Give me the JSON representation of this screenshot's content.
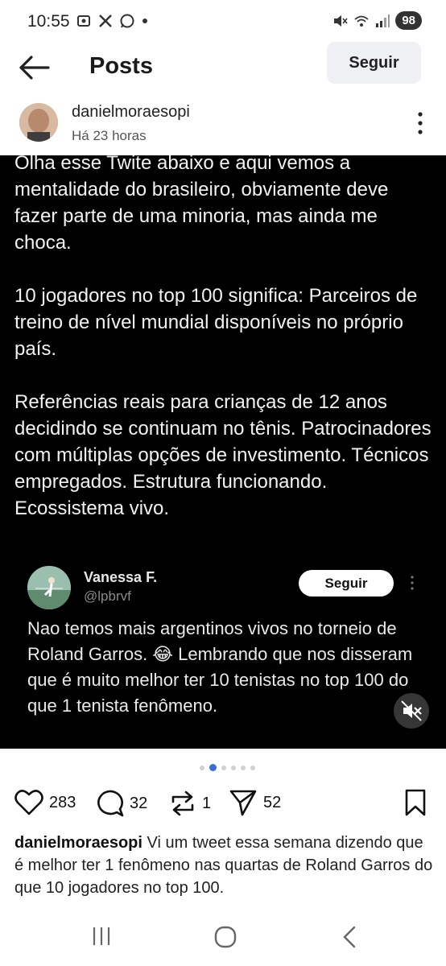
{
  "status_bar": {
    "time": "10:55",
    "battery": "98"
  },
  "header": {
    "title": "Posts",
    "follow_label": "Seguir"
  },
  "post": {
    "username": "danielmoraesopi",
    "timestamp": "Há 23 horas",
    "media_text": [
      "Olha esse Twite abaixo e aqui vemos a mentalidade do brasileiro, obviamente deve fazer parte de uma minoria, mas ainda me choca.",
      "10 jogadores no top 100 significa: Parceiros de treino de nível mundial disponíveis no próprio país.",
      "Referências reais para crianças de 12 anos decidindo se continuam no tênis. Patrocinadores com múltiplas opções de investimento. Técnicos empregados. Estrutura funcionando. Ecossistema vivo."
    ],
    "embedded": {
      "name": "Vanessa F.",
      "handle": "@lpbrvf",
      "follow_label": "Seguir",
      "text": "Nao temos mais argentinos vivos no torneio de Roland Garros. 😂 Lembrando que nos disseram que é muito melhor ter 10 tenistas no top 100 do que 1 tenista fenômeno."
    },
    "likes": "283",
    "comments": "32",
    "reposts": "1",
    "shares": "52",
    "caption_user": "danielmoraesopi",
    "caption_text": "Vi um tweet essa semana dizendo que é melhor ter 1 fenômeno nas quartas de Roland Garros do que 10 jogadores no top 100."
  },
  "carousel": {
    "total": 6,
    "active": 2
  },
  "icons": {
    "back": "arrow-left-icon",
    "more": "more-vertical-icon",
    "like": "heart-icon",
    "comment": "comment-icon",
    "repost": "repost-icon",
    "share": "send-icon",
    "save": "bookmark-icon",
    "mute": "volume-mute-icon"
  },
  "colors": {
    "accent": "#3b6fd6",
    "media_bg": "#000000",
    "follow_bg": "#eef0f3"
  }
}
